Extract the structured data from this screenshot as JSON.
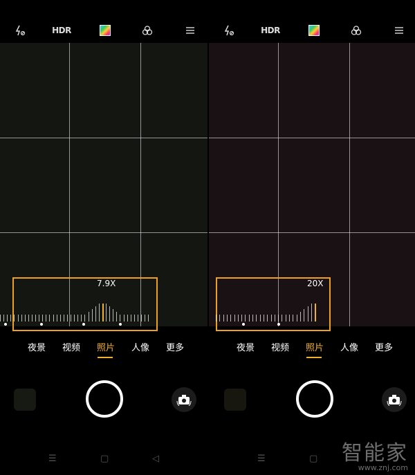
{
  "colors": {
    "accent": "#f0a020",
    "zoom_box": "#f0a020",
    "background": "#000000"
  },
  "panels": [
    {
      "top_bar": {
        "flash_icon": "flash-off-icon",
        "hdr_label": "HDR",
        "filter_icon": "filter-icon",
        "effects_icon": "effects-icon",
        "menu_icon": "menu-icon"
      },
      "zoom": {
        "value": "7.9X"
      },
      "modes": [
        {
          "label": "夜景"
        },
        {
          "label": "视频"
        },
        {
          "label": "照片",
          "active": true
        },
        {
          "label": "人像"
        },
        {
          "label": "更多"
        }
      ]
    },
    {
      "top_bar": {
        "flash_icon": "flash-off-icon",
        "hdr_label": "HDR",
        "filter_icon": "filter-icon",
        "effects_icon": "effects-icon",
        "menu_icon": "menu-icon"
      },
      "zoom": {
        "value": "20X"
      },
      "modes": [
        {
          "label": "夜景"
        },
        {
          "label": "视频"
        },
        {
          "label": "照片",
          "active": true
        },
        {
          "label": "人像"
        },
        {
          "label": "更多"
        }
      ]
    }
  ],
  "watermark": {
    "text": "智能家",
    "url": "www.znj.com"
  }
}
